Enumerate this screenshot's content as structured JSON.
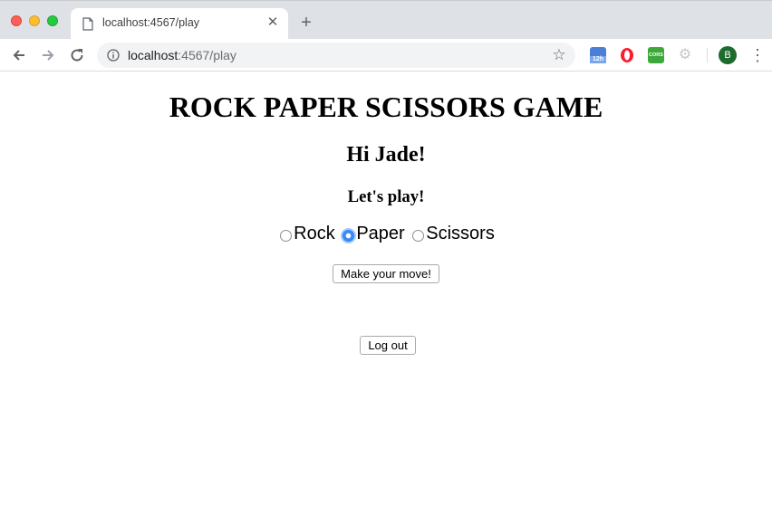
{
  "browser": {
    "tab_title": "localhost:4567/play",
    "url_host": "localhost",
    "url_path": ":4567/play",
    "extensions": [
      "12h",
      "opera",
      "CORS",
      "gear"
    ],
    "profile_initial": "B"
  },
  "game": {
    "title": "ROCK PAPER SCISSORS GAME",
    "greeting": "Hi Jade!",
    "prompt": "Let's play!",
    "options": [
      {
        "label": "Rock",
        "checked": false
      },
      {
        "label": "Paper",
        "checked": true
      },
      {
        "label": "Scissors",
        "checked": false
      }
    ],
    "submit_label": "Make your move!",
    "logout_label": "Log out"
  },
  "colors": {
    "accent": "#3a8df9",
    "profile_bg": "#1e6b2f"
  }
}
